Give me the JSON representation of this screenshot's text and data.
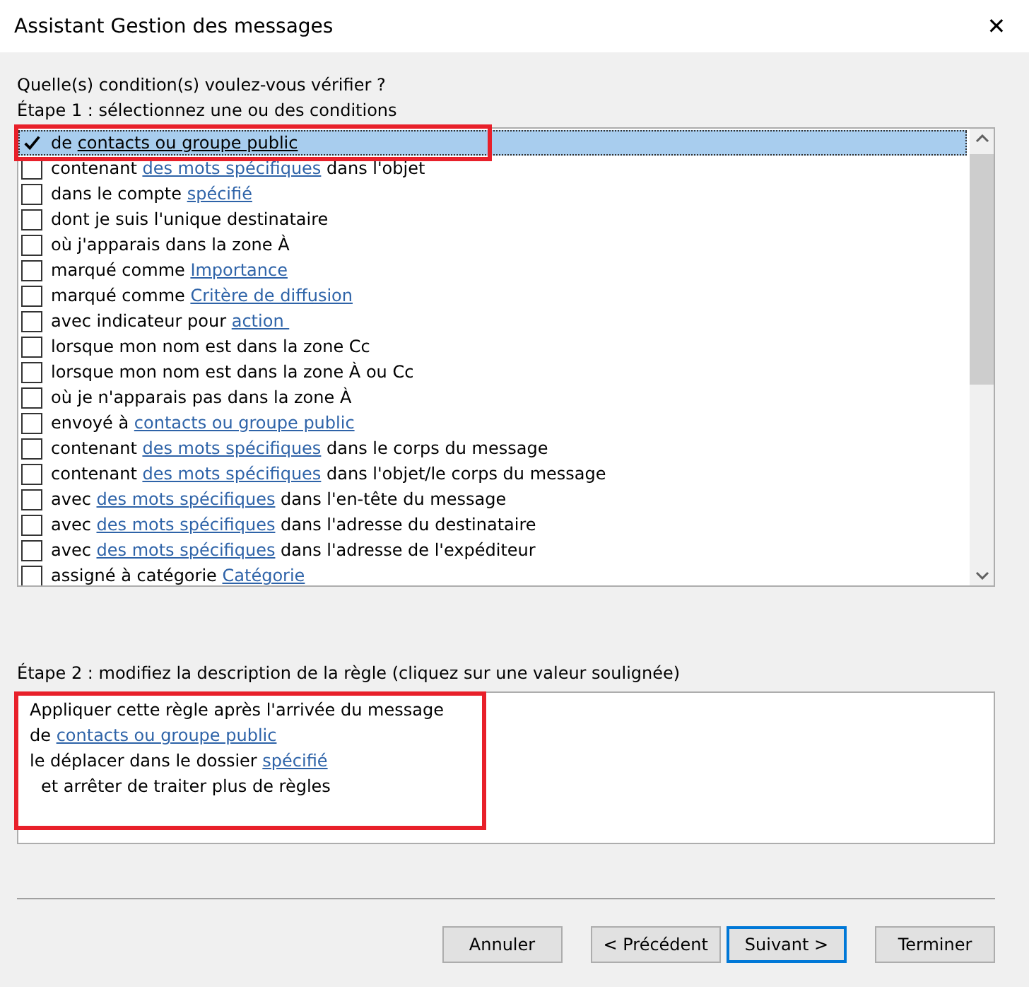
{
  "window": {
    "title": "Assistant Gestion des messages",
    "close": "✕"
  },
  "question": "Quelle(s) condition(s) voulez-vous vérifier ?",
  "step1": "Étape 1 : sélectionnez une ou des conditions",
  "conditions": [
    {
      "checked": true,
      "selected": true,
      "highlighted": true,
      "parts": [
        {
          "kind": "text",
          "text": "de "
        },
        {
          "kind": "link",
          "text": "contacts ou groupe public"
        }
      ]
    },
    {
      "checked": false,
      "selected": false,
      "parts": [
        {
          "kind": "text",
          "text": "contenant "
        },
        {
          "kind": "link",
          "text": "des mots spécifiques"
        },
        {
          "kind": "text",
          "text": " dans l'objet"
        }
      ]
    },
    {
      "checked": false,
      "selected": false,
      "parts": [
        {
          "kind": "text",
          "text": "dans le compte "
        },
        {
          "kind": "link",
          "text": "spécifié"
        }
      ]
    },
    {
      "checked": false,
      "selected": false,
      "parts": [
        {
          "kind": "text",
          "text": "dont je suis l'unique destinataire"
        }
      ]
    },
    {
      "checked": false,
      "selected": false,
      "parts": [
        {
          "kind": "text",
          "text": "où j'apparais dans la zone À"
        }
      ]
    },
    {
      "checked": false,
      "selected": false,
      "parts": [
        {
          "kind": "text",
          "text": "marqué comme "
        },
        {
          "kind": "link",
          "text": "Importance"
        }
      ]
    },
    {
      "checked": false,
      "selected": false,
      "parts": [
        {
          "kind": "text",
          "text": "marqué comme "
        },
        {
          "kind": "link",
          "text": "Critère de diffusion"
        }
      ]
    },
    {
      "checked": false,
      "selected": false,
      "parts": [
        {
          "kind": "text",
          "text": "avec indicateur pour "
        },
        {
          "kind": "link",
          "text": "action "
        }
      ]
    },
    {
      "checked": false,
      "selected": false,
      "parts": [
        {
          "kind": "text",
          "text": "lorsque mon nom est dans la zone Cc"
        }
      ]
    },
    {
      "checked": false,
      "selected": false,
      "parts": [
        {
          "kind": "text",
          "text": "lorsque mon nom est dans la zone À ou Cc"
        }
      ]
    },
    {
      "checked": false,
      "selected": false,
      "parts": [
        {
          "kind": "text",
          "text": "où je n'apparais pas dans la zone À"
        }
      ]
    },
    {
      "checked": false,
      "selected": false,
      "parts": [
        {
          "kind": "text",
          "text": "envoyé à "
        },
        {
          "kind": "link",
          "text": "contacts ou groupe public"
        }
      ]
    },
    {
      "checked": false,
      "selected": false,
      "parts": [
        {
          "kind": "text",
          "text": "contenant "
        },
        {
          "kind": "link",
          "text": "des mots spécifiques"
        },
        {
          "kind": "text",
          "text": " dans le corps du message"
        }
      ]
    },
    {
      "checked": false,
      "selected": false,
      "parts": [
        {
          "kind": "text",
          "text": "contenant "
        },
        {
          "kind": "link",
          "text": "des mots spécifiques"
        },
        {
          "kind": "text",
          "text": " dans l'objet/le corps du message"
        }
      ]
    },
    {
      "checked": false,
      "selected": false,
      "parts": [
        {
          "kind": "text",
          "text": "avec "
        },
        {
          "kind": "link",
          "text": "des mots spécifiques"
        },
        {
          "kind": "text",
          "text": " dans l'en-tête du message"
        }
      ]
    },
    {
      "checked": false,
      "selected": false,
      "parts": [
        {
          "kind": "text",
          "text": "avec "
        },
        {
          "kind": "link",
          "text": "des mots spécifiques"
        },
        {
          "kind": "text",
          "text": " dans l'adresse du destinataire"
        }
      ]
    },
    {
      "checked": false,
      "selected": false,
      "parts": [
        {
          "kind": "text",
          "text": "avec "
        },
        {
          "kind": "link",
          "text": "des mots spécifiques"
        },
        {
          "kind": "text",
          "text": " dans l'adresse de l'expéditeur"
        }
      ]
    },
    {
      "checked": false,
      "selected": false,
      "parts": [
        {
          "kind": "text",
          "text": "assigné à catégorie "
        },
        {
          "kind": "link",
          "text": "Catégorie"
        }
      ]
    }
  ],
  "step2": "Étape 2 : modifiez la description de la règle (cliquez sur une valeur soulignée)",
  "description": {
    "highlighted": true,
    "lines": [
      {
        "indented": false,
        "parts": [
          {
            "kind": "text",
            "text": "Appliquer cette règle après l'arrivée du message"
          }
        ]
      },
      {
        "indented": false,
        "parts": [
          {
            "kind": "text",
            "text": "de "
          },
          {
            "kind": "link",
            "text": "contacts ou groupe public"
          }
        ]
      },
      {
        "indented": false,
        "parts": [
          {
            "kind": "text",
            "text": "le déplacer dans le dossier "
          },
          {
            "kind": "link",
            "text": "spécifié"
          }
        ]
      },
      {
        "indented": true,
        "parts": [
          {
            "kind": "text",
            "text": "et arrêter de traiter plus de règles"
          }
        ]
      }
    ]
  },
  "buttons": [
    {
      "label": "Annuler",
      "focused": false
    },
    {
      "label": "< Précédent",
      "focused": false
    },
    {
      "label": "Suivant >",
      "focused": true
    },
    {
      "label": "Terminer",
      "focused": false
    }
  ]
}
